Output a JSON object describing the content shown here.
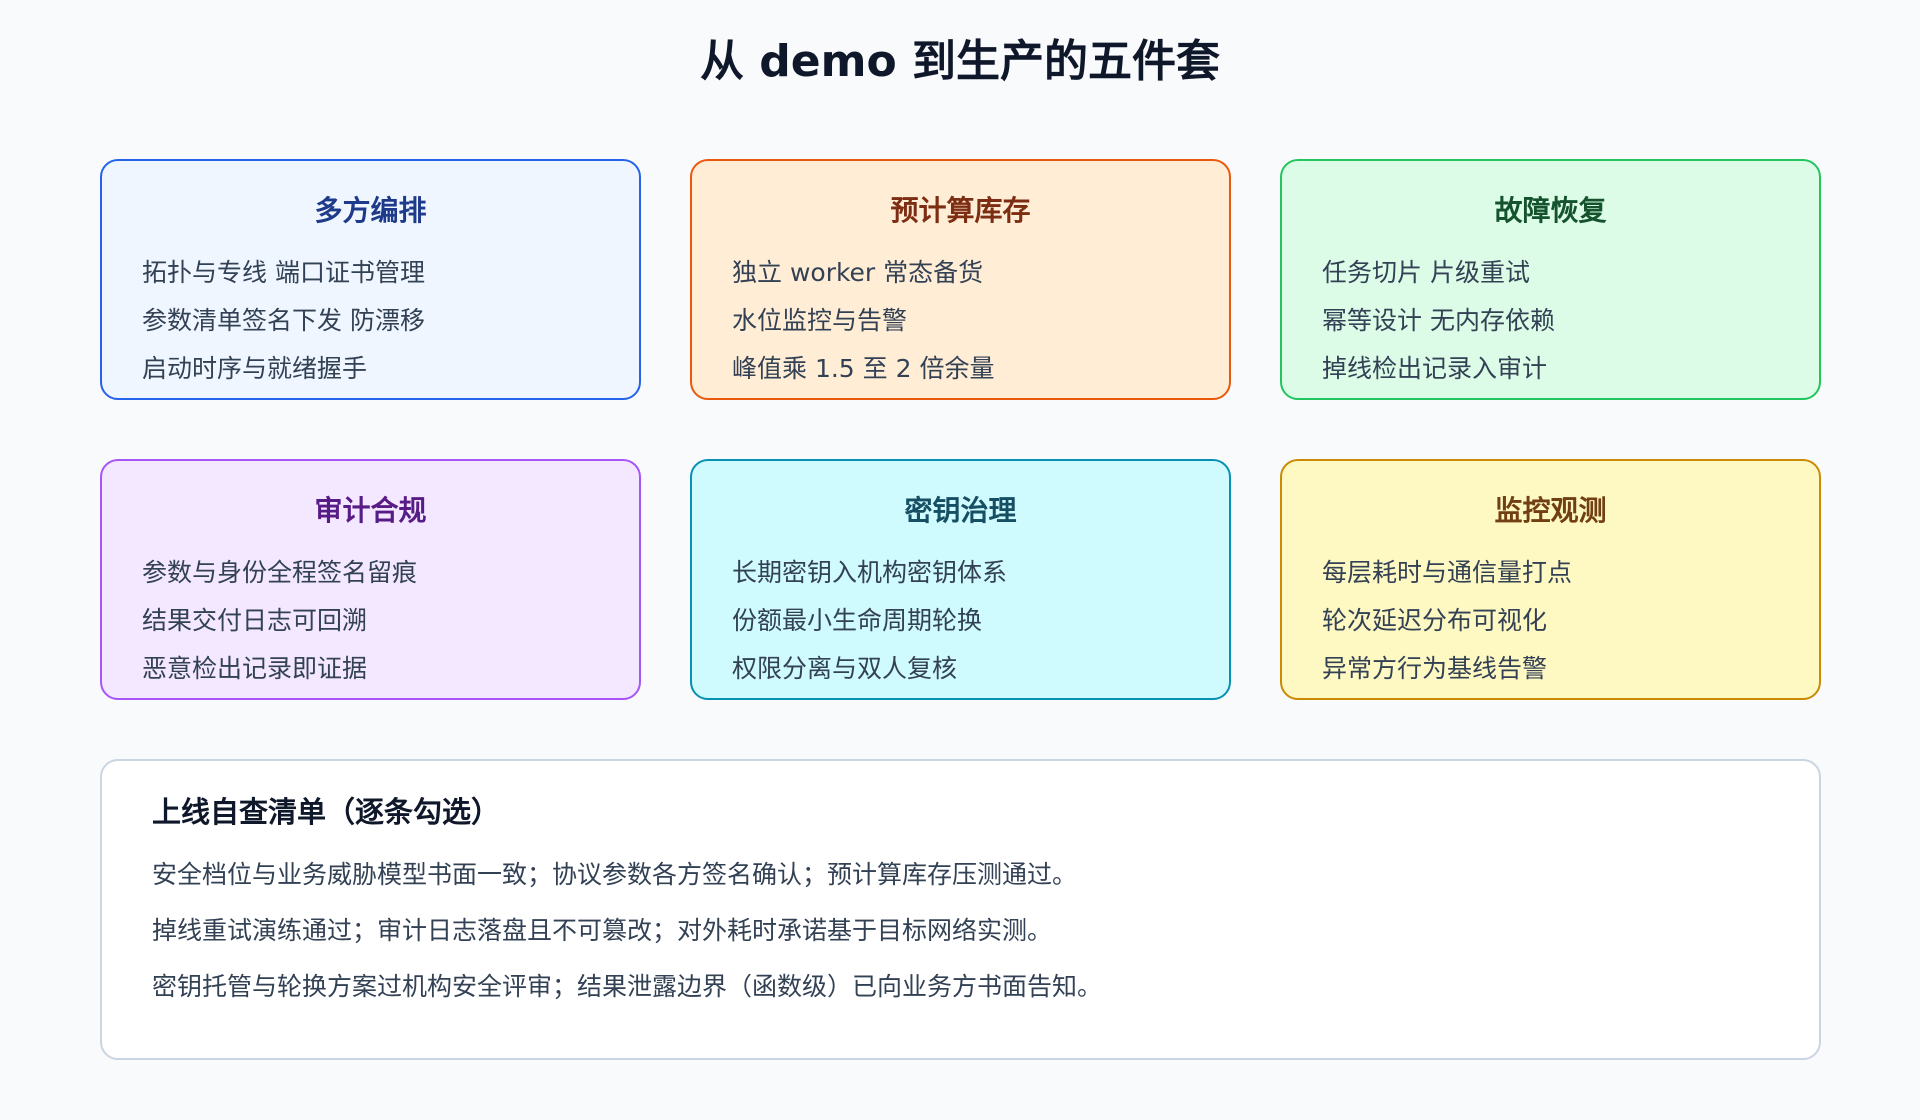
{
  "title": "从 demo 到生产的五件套",
  "cards": [
    {
      "title": "多方编排",
      "lines": [
        "拓扑与专线 端口证书管理",
        "参数清单签名下发 防漂移",
        "启动时序与就绪握手"
      ],
      "bg": "#eff6ff",
      "border": "#2563eb",
      "title_color": "#1e3a8a"
    },
    {
      "title": "预计算库存",
      "lines": [
        "独立 worker 常态备货",
        "水位监控与告警",
        "峰值乘 1.5 至 2 倍余量"
      ],
      "bg": "#ffedd5",
      "border": "#ea580c",
      "title_color": "#7c2d12"
    },
    {
      "title": "故障恢复",
      "lines": [
        "任务切片 片级重试",
        "幂等设计 无内存依赖",
        "掉线检出记录入审计"
      ],
      "bg": "#dcfce7",
      "border": "#22c55e",
      "title_color": "#14532d"
    },
    {
      "title": "审计合规",
      "lines": [
        "参数与身份全程签名留痕",
        "结果交付日志可回溯",
        "恶意检出记录即证据"
      ],
      "bg": "#f3e8ff",
      "border": "#a855f7",
      "title_color": "#581c87"
    },
    {
      "title": "密钥治理",
      "lines": [
        "长期密钥入机构密钥体系",
        "份额最小生命周期轮换",
        "权限分离与双人复核"
      ],
      "bg": "#cffafe",
      "border": "#0891b2",
      "title_color": "#164e63"
    },
    {
      "title": "监控观测",
      "lines": [
        "每层耗时与通信量打点",
        "轮次延迟分布可视化",
        "异常方行为基线告警"
      ],
      "bg": "#fef9c3",
      "border": "#ca8a04",
      "title_color": "#713f12"
    }
  ],
  "checklist": {
    "title": "上线自查清单（逐条勾选）",
    "items": [
      "安全档位与业务威胁模型书面一致；协议参数各方签名确认；预计算库存压测通过。",
      "掉线重试演练通过；审计日志落盘且不可篡改；对外耗时承诺基于目标网络实测。",
      "密钥托管与轮换方案过机构安全评审；结果泄露边界（函数级）已向业务方书面告知。"
    ]
  }
}
